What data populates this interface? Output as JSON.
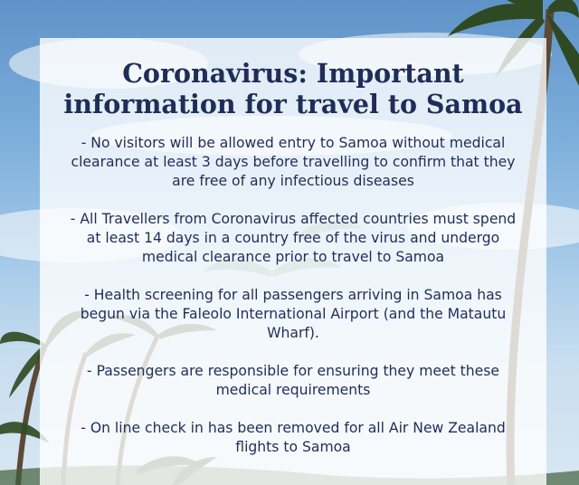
{
  "poster": {
    "title_lines": [
      "Coronavirus: Important",
      "information for travel to Samoa"
    ],
    "bullets": [
      "- No visitors will be allowed entry to Samoa without medical\nclearance at least 3 days before travelling to confirm that they\nare free of any infectious diseases",
      "- All Travellers from Coronavirus affected countries must spend\nat least 14 days in a country free of the virus and undergo\nmedical clearance prior to travel to Samoa",
      "- Health screening for all passengers arriving in Samoa has\nbegun via the Faleolo International Airport (and the Matautu\nWharf).",
      "- Passengers are responsible for ensuring they meet these\nmedical requirements",
      "- On line check in has been removed for all Air New Zealand\nflights to Samoa"
    ]
  },
  "colors": {
    "text": "#1f2d57",
    "sky_top": "#5f93c8",
    "sky_bottom": "#d8e6f1",
    "palm": "#2f4a22"
  }
}
